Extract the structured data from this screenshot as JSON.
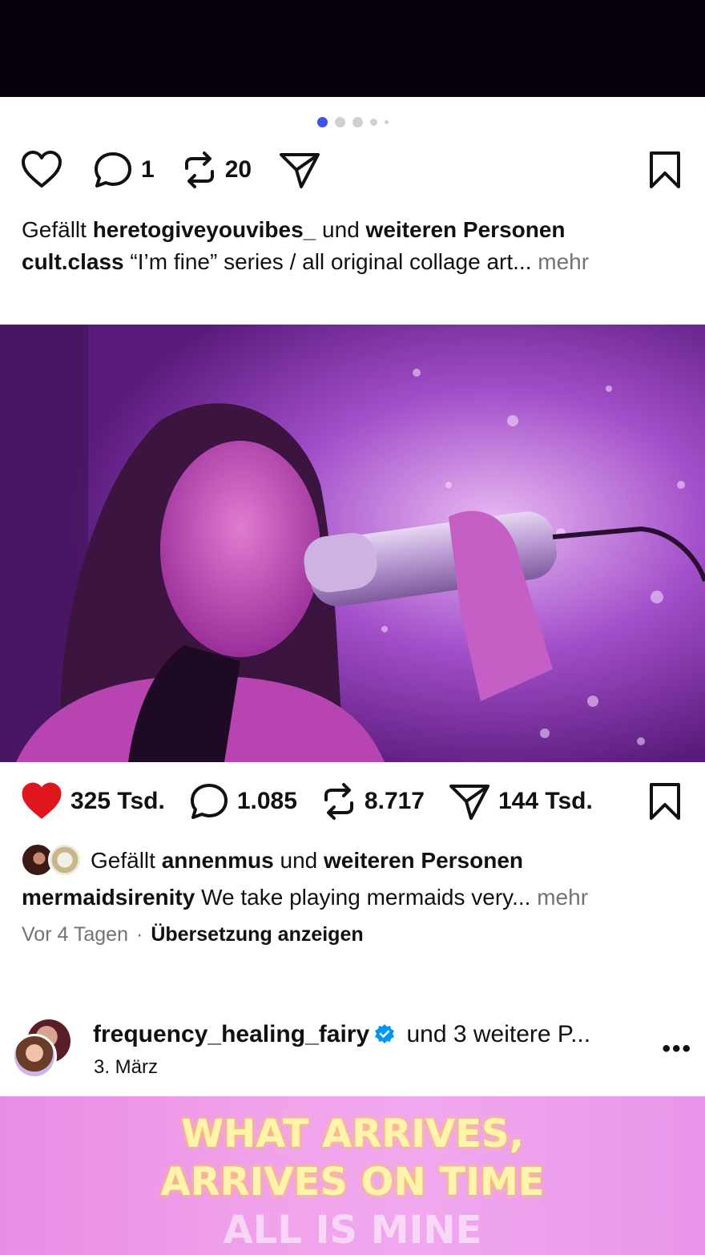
{
  "post1": {
    "carousel": {
      "count": 5,
      "active_index": 0
    },
    "actions": {
      "like_icon": "heart-outline-icon",
      "comments": "1",
      "reposts": "20",
      "share_icon": "paper-plane-icon",
      "save_icon": "bookmark-icon"
    },
    "likes": {
      "prefix": "Gefällt ",
      "user": "heretogiveyouvibes_",
      "middle": " und ",
      "rest": "weiteren Personen"
    },
    "caption": {
      "user": "cult.class",
      "text": " “I’m fine” series / all original collage art...",
      "more": " mehr"
    }
  },
  "post2": {
    "image_alt": "Frau singt in ein Mikrofon vor silberner Folie in lila Licht",
    "actions": {
      "likes": "325 Tsd.",
      "comments": "1.085",
      "reposts": "8.717",
      "shares": "144 Tsd.",
      "like_color": "#e0161e"
    },
    "likes": {
      "prefix": "Gefällt ",
      "user": "annenmus",
      "middle": " und ",
      "rest": "weiteren Personen"
    },
    "caption": {
      "user": "mermaidsirenity",
      "text": " We take playing mermaids very...",
      "more": " mehr"
    },
    "meta": {
      "time": "Vor 4 Tagen",
      "separator": "·",
      "translate": "Übersetzung anzeigen"
    }
  },
  "post3": {
    "username": "frequency_healing_fairy",
    "collab_suffix": " und 3 weitere P...",
    "date": "3. März",
    "more_icon": "more-horizontal-icon",
    "overlay_text": [
      "WHAT ARRIVES,",
      "ARRIVES ON TIME",
      "ALL IS MINE"
    ]
  },
  "colors": {
    "accent": "#3d54e6",
    "verified": "#0095f6",
    "text": "#111111",
    "muted": "#737373"
  }
}
